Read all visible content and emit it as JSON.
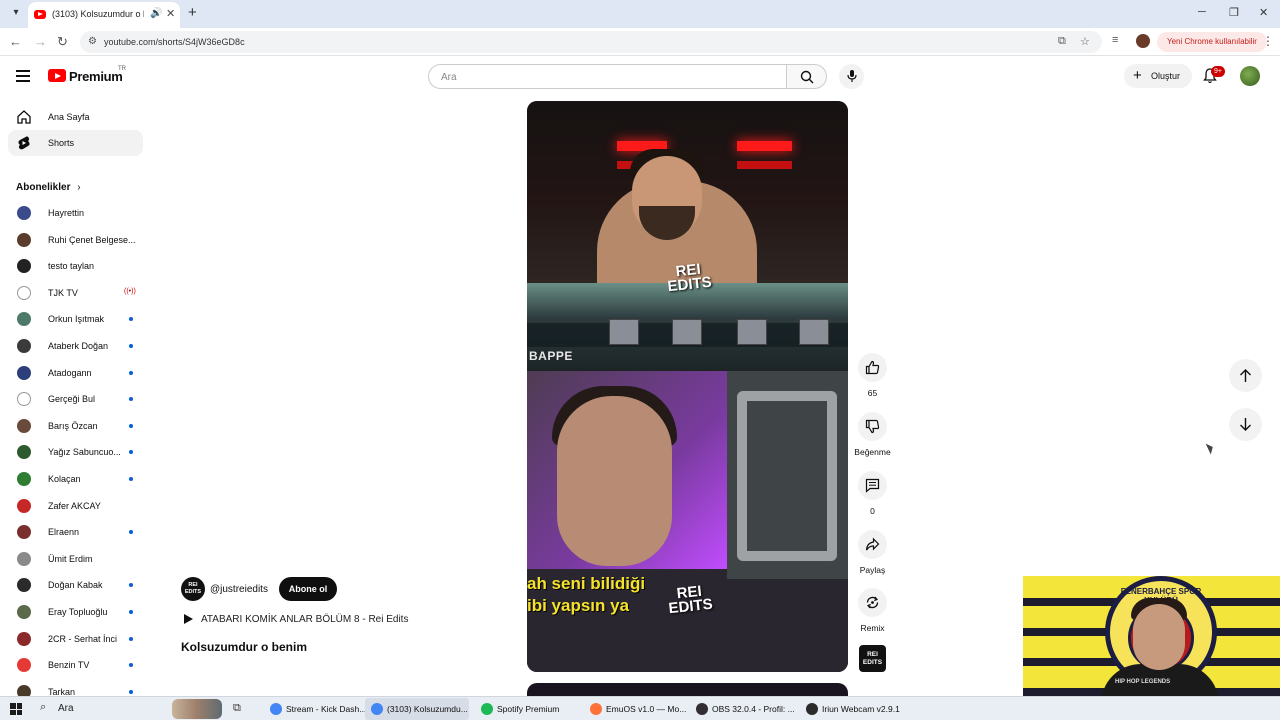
{
  "browser": {
    "tab_title": "(3103) Kolsuzumdur o benim",
    "url": "youtube.com/shorts/S4jW36eGD8c",
    "update_label": "Yeni Chrome kullanılabilir"
  },
  "youtube": {
    "brand": "Premium",
    "country": "TR",
    "search_placeholder": "Ara",
    "create_label": "Oluştur",
    "notification_count": "9+"
  },
  "sidebar": {
    "nav": [
      {
        "label": "Ana Sayfa",
        "icon": "home-icon"
      },
      {
        "label": "Shorts",
        "icon": "shorts-icon"
      }
    ],
    "subscriptions_title": "Abonelikler",
    "subscriptions": [
      {
        "name": "Hayrettin",
        "color": "#3a4a8a",
        "indicator": ""
      },
      {
        "name": "Ruhi Çenet Belgese...",
        "color": "#5a3d2b",
        "indicator": ""
      },
      {
        "name": "testo taylan",
        "color": "#222222",
        "indicator": ""
      },
      {
        "name": "TJK TV",
        "color": "#ffffff",
        "indicator": "live"
      },
      {
        "name": "Orkun Işıtmak",
        "color": "#4e7a6a",
        "indicator": "dot"
      },
      {
        "name": "Ataberk Doğan",
        "color": "#3b3b3b",
        "indicator": "dot"
      },
      {
        "name": "Atadogann",
        "color": "#2d3f7a",
        "indicator": "dot"
      },
      {
        "name": "Gerçeği Bul",
        "color": "#ffffff",
        "indicator": "dot"
      },
      {
        "name": "Barış Özcan",
        "color": "#6a4a3a",
        "indicator": "dot"
      },
      {
        "name": "Yağız Sabuncuo...",
        "color": "#2f5a2f",
        "indicator": "dot"
      },
      {
        "name": "Kolaçan",
        "color": "#2e7d32",
        "indicator": "dot"
      },
      {
        "name": "Zafer AKCAY",
        "color": "#c62828",
        "indicator": ""
      },
      {
        "name": "Elraenn",
        "color": "#7a2f2f",
        "indicator": "dot"
      },
      {
        "name": "Ümit Erdim",
        "color": "#8a8a8a",
        "indicator": ""
      },
      {
        "name": "Doğan Kabak",
        "color": "#2a2a2a",
        "indicator": "dot"
      },
      {
        "name": "Eray Topluoğlu",
        "color": "#5a6a4a",
        "indicator": "dot"
      },
      {
        "name": "2CR - Serhat İnci",
        "color": "#8a2a2a",
        "indicator": "dot"
      },
      {
        "name": "Benzin TV",
        "color": "#e53935",
        "indicator": "dot"
      },
      {
        "name": "Tarkan",
        "color": "#4a3a2a",
        "indicator": "dot"
      }
    ]
  },
  "short": {
    "channel_handle": "@justreiedits",
    "channel_avatar_text": "REI EDITS",
    "subscribe_label": "Abone ol",
    "playlist_title": "ATABARI KOMİK ANLAR BÖLÜM 8 - Rei Edits",
    "title": "Kolsuzumdur o benim",
    "overlay_name": "BAPPE",
    "caption_line1": "ah seni bilidiği",
    "caption_line2": "ibi yapsın ya",
    "watermark": "REI EDITS",
    "likes": "65",
    "dislike_label": "Beğenme",
    "comments": "0",
    "share_label": "Paylaş",
    "remix_label": "Remix"
  },
  "webcam": {
    "emblem_text": "FENERBAHÇE SPOR KULÜBÜ",
    "shirt_text": "HIP HOP LEGENDS"
  },
  "taskbar": {
    "search_label": "Ara",
    "apps": [
      {
        "label": "Stream - Kick Dash...",
        "color": "#4285f4",
        "active": false
      },
      {
        "label": "(3103) Kolsuzumdu...",
        "color": "#4285f4",
        "active": true
      },
      {
        "label": "Spotify Premium",
        "color": "#1db954",
        "active": false
      },
      {
        "label": "EmuOS v1.0 — Mo...",
        "color": "#ff7139",
        "active": false
      },
      {
        "label": "OBS 32.0.4 - Profil: ...",
        "color": "#302e31",
        "active": false
      },
      {
        "label": "Iriun Webcam v2.9.1",
        "color": "#2b2b2b",
        "active": false
      }
    ]
  }
}
